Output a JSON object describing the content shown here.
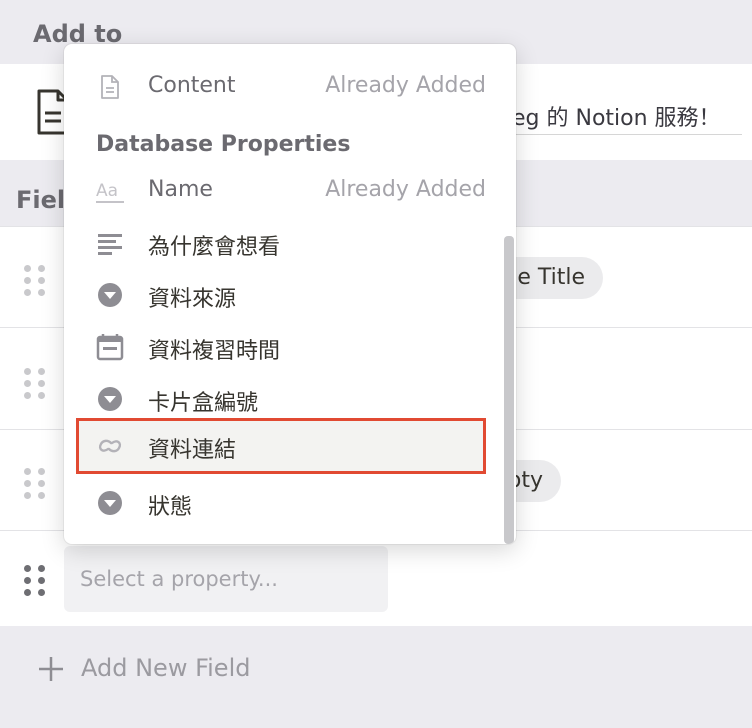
{
  "add_to": {
    "title": "Add to",
    "page_title": "eg 的 Notion 服務！"
  },
  "fields": {
    "label": "Fiel",
    "rows": [
      {
        "pill": "e Title"
      },
      {
        "pill": ""
      },
      {
        "pill": "oty"
      }
    ],
    "select_placeholder": "Select a property..."
  },
  "footer": {
    "add_new_field": "Add New Field"
  },
  "dropdown": {
    "content_item": {
      "label": "Content",
      "status": "Already Added",
      "icon": "document-icon"
    },
    "section_heading": "Database Properties",
    "properties": [
      {
        "label": "Name",
        "status": "Already Added",
        "icon": "title-aa-icon"
      },
      {
        "label": "為什麼會想看",
        "status": "",
        "icon": "text-lines-icon"
      },
      {
        "label": "資料來源",
        "status": "",
        "icon": "select-icon"
      },
      {
        "label": "資料複習時間",
        "status": "",
        "icon": "calendar-icon"
      },
      {
        "label": "卡片盒編號",
        "status": "",
        "icon": "select-icon"
      },
      {
        "label": "資料連結",
        "status": "",
        "icon": "link-icon",
        "highlighted": true
      },
      {
        "label": "狀態",
        "status": "",
        "icon": "select-icon"
      }
    ]
  },
  "colors": {
    "background": "#ecebf0",
    "highlight_border": "#e14a32",
    "muted_text": "#a5a4aa"
  }
}
